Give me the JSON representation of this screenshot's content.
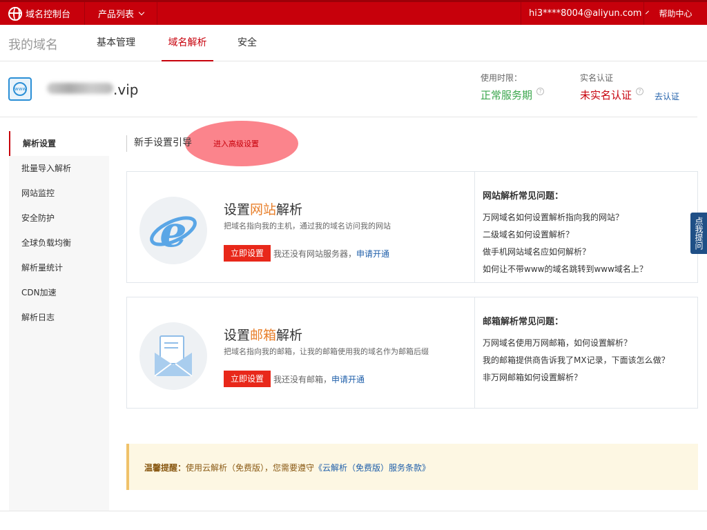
{
  "topbar": {
    "logo_label": "域名控制台",
    "products_label": "产品列表",
    "user_label": "hi3****8004@aliyun.com",
    "help_label": "帮助中心"
  },
  "subnav": {
    "title": "我的域名",
    "tabs": [
      {
        "label": "基本管理"
      },
      {
        "label": "域名解析"
      },
      {
        "label": "安全"
      }
    ]
  },
  "domain": {
    "suffix": ".vip",
    "usage_label": "使用时限：",
    "usage_value": "正常服务期",
    "usage_color": "#3aa64c",
    "realname_label": "实名认证",
    "realname_value": "未实名认证",
    "realname_color": "#c7000b",
    "verify_link": "去认证"
  },
  "sidebar": {
    "items": [
      {
        "label": "解析设置"
      },
      {
        "label": "批量导入解析"
      },
      {
        "label": "网站监控"
      },
      {
        "label": "安全防护"
      },
      {
        "label": "全球负载均衡"
      },
      {
        "label": "解析量统计"
      },
      {
        "label": "CDN加速"
      },
      {
        "label": "解析日志"
      }
    ]
  },
  "guide": {
    "title": "新手设置引导",
    "advanced_link": "进入高级设置"
  },
  "website_card": {
    "title_pre": "设置",
    "title_accent": "网站",
    "title_post": "解析",
    "desc": "把域名指向我的主机，通过我的域名访问我的网站",
    "button": "立即设置",
    "note": "我还没有网站服务器，",
    "note_link": "申请开通",
    "faq_title": "网站解析常见问题：",
    "faqs": [
      "万网域名如何设置解析指向我的网站？",
      "二级域名如何设置解析？",
      "做手机网站域名应如何解析？",
      "如何让不带www的域名跳转到www域名上？"
    ]
  },
  "mail_card": {
    "title_pre": "设置",
    "title_accent": "邮箱",
    "title_post": "解析",
    "desc": "把域名指向我的邮箱，让我的邮箱使用我的域名作为邮箱后缀",
    "button": "立即设置",
    "note": "我还没有邮箱，",
    "note_link": "申请开通",
    "faq_title": "邮箱解析常见问题：",
    "faqs": [
      "万网域名使用万网邮箱，如何设置解析？",
      "我的邮箱提供商告诉我了MX记录，下面该怎么做？",
      "非万网邮箱如何设置解析？"
    ]
  },
  "tip": {
    "label": "温馨提醒：",
    "text": "使用云解析（免费版），您需要遵守",
    "link": "《云解析（免费版）服务条款》"
  },
  "float_button": "点我提问"
}
